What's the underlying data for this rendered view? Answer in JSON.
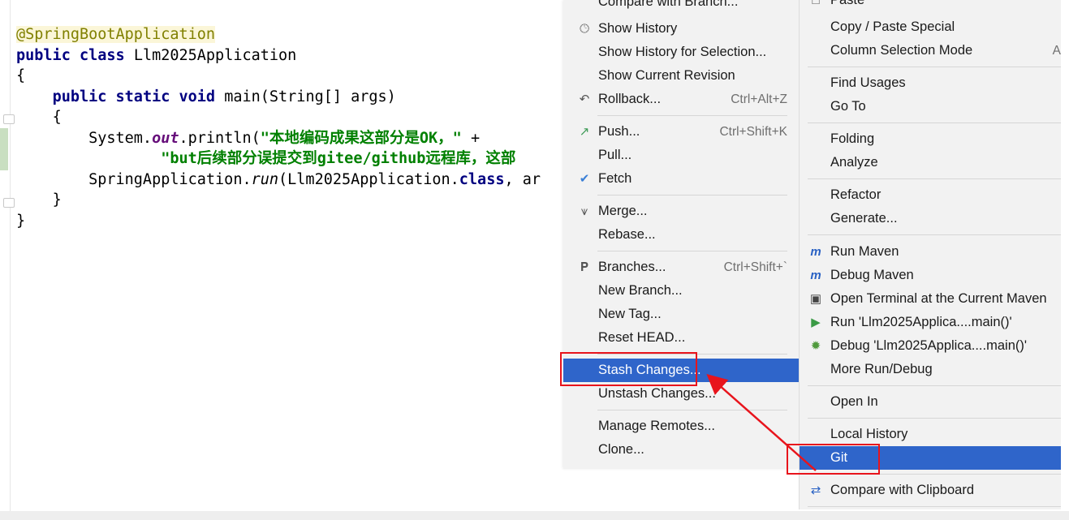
{
  "editor": {
    "line1_annotation": "@SpringBootApplication",
    "line2_kw1": "public",
    "line2_kw2": "class",
    "line2_rest": "Llm2025Application",
    "line3": "{",
    "line4_kw1": "public",
    "line4_kw2": "static",
    "line4_kw3": "void",
    "line4_rest": "main(String[] args)",
    "line5": "{",
    "line6_pre": "System.",
    "line6_field": "out",
    "line6_mid": ".println(",
    "line6_str": "\"本地编码成果这部分是OK，\"",
    "line6_post": " +",
    "line7_str": "\"but后续部分误提交到gitee/github远程库，这部",
    "line8_pre": "SpringApplication.",
    "line8_method": "run",
    "line8_mid": "(Llm2025Application.",
    "line8_kw": "class",
    "line8_post": ", ar",
    "line9": "}",
    "line10": "}"
  },
  "git_menu": {
    "items": [
      {
        "label": "Compare with Branch...",
        "shortcut": "",
        "icon": ""
      },
      {
        "label": "Show History",
        "shortcut": "",
        "icon": "clock-icon"
      },
      {
        "label": "Show History for Selection...",
        "shortcut": "",
        "icon": ""
      },
      {
        "label": "Show Current Revision",
        "shortcut": "",
        "icon": ""
      },
      {
        "label": "Rollback...",
        "shortcut": "Ctrl+Alt+Z",
        "icon": "rollback-icon"
      },
      {
        "label": "Push...",
        "shortcut": "Ctrl+Shift+K",
        "icon": "push-arrow-icon"
      },
      {
        "label": "Pull...",
        "shortcut": "",
        "icon": ""
      },
      {
        "label": "Fetch",
        "shortcut": "",
        "icon": "fetch-check-icon"
      },
      {
        "label": "Merge...",
        "shortcut": "",
        "icon": "merge-icon"
      },
      {
        "label": "Rebase...",
        "shortcut": "",
        "icon": ""
      },
      {
        "label": "Branches...",
        "shortcut": "Ctrl+Shift+`",
        "icon": "branch-icon"
      },
      {
        "label": "New Branch...",
        "shortcut": "",
        "icon": ""
      },
      {
        "label": "New Tag...",
        "shortcut": "",
        "icon": ""
      },
      {
        "label": "Reset HEAD...",
        "shortcut": "",
        "icon": ""
      },
      {
        "label": "Stash Changes...",
        "shortcut": "",
        "icon": ""
      },
      {
        "label": "Unstash Changes...",
        "shortcut": "",
        "icon": ""
      },
      {
        "label": "Manage Remotes...",
        "shortcut": "",
        "icon": ""
      },
      {
        "label": "Clone...",
        "shortcut": "",
        "icon": ""
      }
    ]
  },
  "context_menu": {
    "items": [
      {
        "label": "Paste",
        "shortcut": "",
        "icon": "paste-icon"
      },
      {
        "label": "Copy / Paste Special",
        "shortcut": "",
        "icon": ""
      },
      {
        "label": "Column Selection Mode",
        "shortcut": "A",
        "icon": ""
      },
      {
        "label": "Find Usages",
        "shortcut": "",
        "icon": ""
      },
      {
        "label": "Go To",
        "shortcut": "",
        "icon": ""
      },
      {
        "label": "Folding",
        "shortcut": "",
        "icon": ""
      },
      {
        "label": "Analyze",
        "shortcut": "",
        "icon": ""
      },
      {
        "label": "Refactor",
        "shortcut": "",
        "icon": ""
      },
      {
        "label": "Generate...",
        "shortcut": "",
        "icon": ""
      },
      {
        "label": "Run Maven",
        "shortcut": "",
        "icon": "maven-run-icon"
      },
      {
        "label": "Debug Maven",
        "shortcut": "",
        "icon": "maven-debug-icon"
      },
      {
        "label": "Open Terminal at the Current Maven",
        "shortcut": "",
        "icon": "terminal-icon"
      },
      {
        "label": "Run 'Llm2025Applica....main()'",
        "shortcut": "",
        "icon": "run-icon"
      },
      {
        "label": "Debug 'Llm2025Applica....main()'",
        "shortcut": "",
        "icon": "debug-bug-icon"
      },
      {
        "label": "More Run/Debug",
        "shortcut": "",
        "icon": ""
      },
      {
        "label": "Open In",
        "shortcut": "",
        "icon": ""
      },
      {
        "label": "Local History",
        "shortcut": "",
        "icon": ""
      },
      {
        "label": "Git",
        "shortcut": "",
        "icon": ""
      },
      {
        "label": "Compare with Clipboard",
        "shortcut": "",
        "icon": "compare-icon"
      }
    ]
  },
  "colors": {
    "selection": "#2f65ca",
    "highlight_box": "#e8141c",
    "menu_bg": "#f2f2f2"
  }
}
